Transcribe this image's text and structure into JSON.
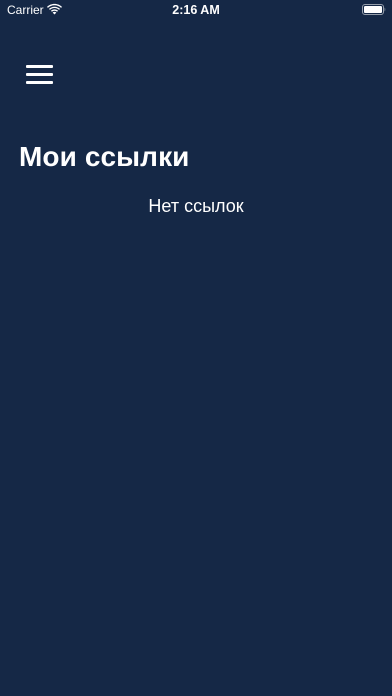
{
  "status_bar": {
    "carrier": "Carrier",
    "time": "2:16 AM",
    "wifi_icon": "wifi-icon",
    "battery_icon": "battery-icon"
  },
  "header": {
    "menu_icon": "hamburger-menu-icon",
    "title": "Мои ссылки"
  },
  "main": {
    "empty_text": "Нет ссылок"
  },
  "colors": {
    "background": "#152846",
    "text": "#ffffff"
  }
}
